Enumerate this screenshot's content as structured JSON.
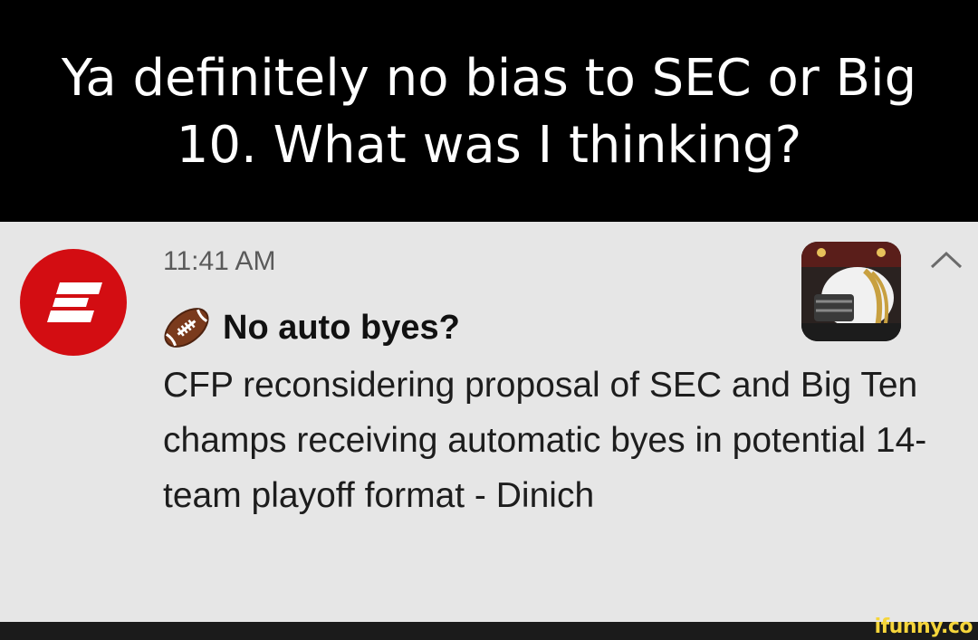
{
  "caption": "Ya definitely no bias to SEC or Big 10. What was I thinking?",
  "notification": {
    "app": "ESPN",
    "time": "11:41 AM",
    "title": "No auto byes?",
    "body": "CFP reconsidering proposal of SEC and Big Ten champs receiving automatic byes in potential 14-team playoff format - Dinich",
    "icons": {
      "app_icon": "espn-logo-icon",
      "title_icon": "american-football-emoji-icon",
      "expand_icon": "chevron-up-icon",
      "thumbnail": "football-helmet-photo"
    }
  },
  "colors": {
    "espn_red": "#d30d12",
    "card_bg": "#e6e6e6",
    "caption_bg": "#000000",
    "watermark": "#f5d53b"
  },
  "watermark": "ifunny.co"
}
